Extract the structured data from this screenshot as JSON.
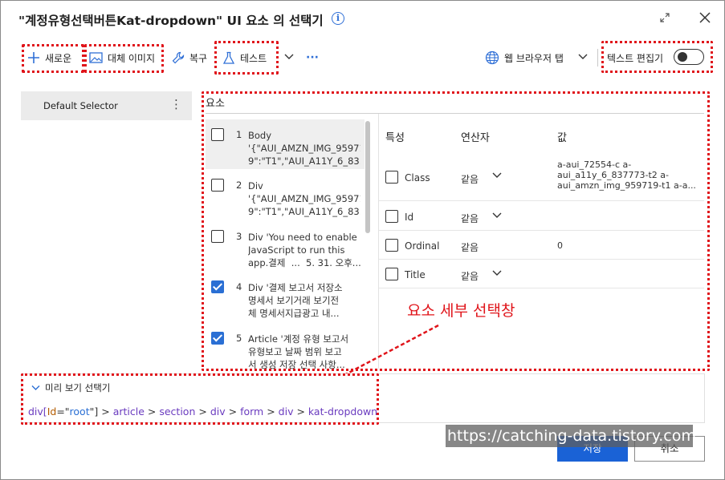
{
  "dialog": {
    "title": "\"계정유형선택버튼Kat-dropdown\" UI 요소 의 선택기",
    "info_icon": "info-icon",
    "expand_icon": "expand-icon",
    "close_icon": "close-icon"
  },
  "toolbar": {
    "new_label": "새로운",
    "alt_image_label": "대체 이미지",
    "repair_label": "복구",
    "test_label": "테스트",
    "more_label": "···",
    "browser_tab_label": "웹 브라우저 탭",
    "text_editor_label": "텍스트 편집기",
    "text_editor_on": false
  },
  "sidebar": {
    "selector_name": "Default Selector",
    "more_label": "⋮"
  },
  "elements": {
    "title": "요소",
    "items": [
      {
        "num": "1",
        "text": "Body\n'{\"AUI_AMZN_IMG_95971\n9\":\"T1\",\"AUI_A11Y_6_83...",
        "checked": false
      },
      {
        "num": "2",
        "text": "Div\n'{\"AUI_AMZN_IMG_95971\n9\":\"T1\",\"AUI_A11Y_6_83...",
        "checked": false
      },
      {
        "num": "3",
        "text": "Div 'You need to enable\nJavaScript to run this\napp.결제  ...  5. 31. 오후...",
        "checked": false
      },
      {
        "num": "4",
        "text": "Div '결제 보고서 저장소\n명세서 보기거래 보기전\n체 명세서지급광고 내...",
        "checked": true
      },
      {
        "num": "5",
        "text": "Article '계정 유형 보고서\n유형보고 날짜 범위 보고\n서 생성 저장 선택 사항...",
        "checked": true
      }
    ]
  },
  "properties": {
    "col_attr": "특성",
    "col_op": "연산자",
    "col_val": "값",
    "rows": [
      {
        "name": "Class",
        "op": "같음",
        "value": "a-aui_72554-c a-\naui_a11y_6_837773-t2 a-\naui_amzn_img_959719-t1 a-a...",
        "has_dropdown": true,
        "checked": false
      },
      {
        "name": "Id",
        "op": "같음",
        "value": "",
        "has_dropdown": true,
        "checked": false
      },
      {
        "name": "Ordinal",
        "op": "같음",
        "value": "0",
        "has_dropdown": false,
        "checked": false
      },
      {
        "name": "Title",
        "op": "같음",
        "value": "",
        "has_dropdown": true,
        "checked": false
      }
    ]
  },
  "annotation": {
    "label": "요소 세부 선택창"
  },
  "preview": {
    "header": "미리 보기 선택기",
    "path_prefix": "div[",
    "path_id_key": "Id",
    "path_eq": "=\"",
    "path_id_val": "root",
    "path_close": "\"]",
    "segments": [
      "article",
      "section",
      "div",
      "form",
      "div",
      "kat-dropdown"
    ]
  },
  "footer": {
    "save_label": "저장",
    "cancel_label": "취소"
  },
  "watermark": "https://catching-data.tistory.com",
  "colors": {
    "accent": "#1a62d6",
    "annotation_red": "#e0141a",
    "path_purple": "#6a3bbf"
  }
}
